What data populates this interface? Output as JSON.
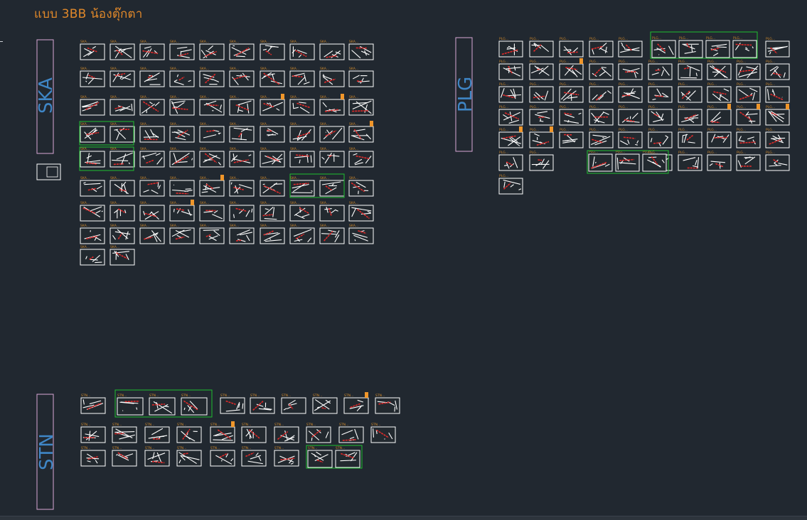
{
  "drawing": {
    "title": "แบบ 3BB น้องตุ๊กตา",
    "groups": [
      {
        "label": "SKA",
        "color": "#3f86c6"
      },
      {
        "label": "PLG",
        "color": "#3f86c6"
      },
      {
        "label": "STN",
        "color": "#3f86c6"
      }
    ],
    "sheet_caption_prefixes": {
      "ska": "SKA",
      "plg": "PLG",
      "stn": "STN"
    },
    "colors": {
      "background": "#212830",
      "title": "#e0882a",
      "caption": "#d08a2c",
      "sheet_line": "#ffffff",
      "route": "#e02a2a",
      "highlight_box": "#1fbf2f",
      "group_frame": "#d9a7d6",
      "marker": "#f0962a"
    }
  }
}
